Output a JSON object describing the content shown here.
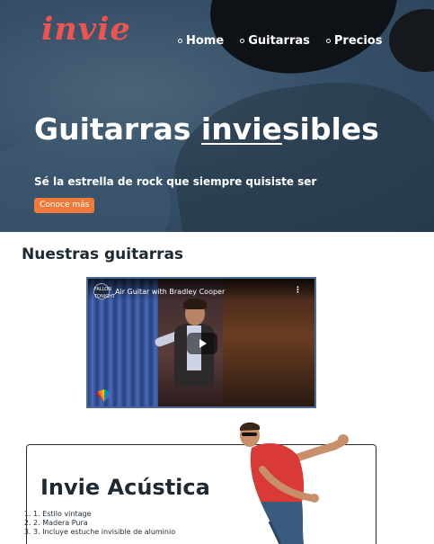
{
  "brand": {
    "logo": "invie",
    "logo_color": "#f0544f"
  },
  "nav": {
    "items": [
      "Home",
      "Guitarras",
      "Precios"
    ]
  },
  "hero": {
    "title_start": "Guitarras ",
    "title_emph": "invie",
    "title_end": "sibles",
    "subtitle": "Sé la estrella de rock que siempre quisiste ser",
    "cta_label": "Conoce más",
    "cta_color": "#f07a3a"
  },
  "guitars": {
    "heading": "Nuestras guitarras",
    "video": {
      "title": "Air Guitar with Bradley Cooper",
      "channel_badge": "FALLON TONIGHT"
    },
    "card": {
      "title": "Invie Acústica",
      "features": [
        "Estilo vintage",
        "Madera Pura",
        "Incluye estuche invisible de aluminio"
      ]
    }
  }
}
